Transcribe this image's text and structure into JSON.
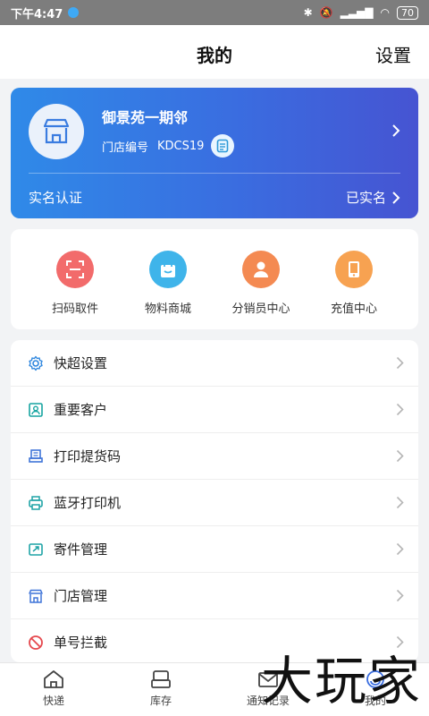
{
  "status_bar": {
    "time": "下午4:47",
    "battery": "70"
  },
  "header": {
    "title": "我的",
    "settings_label": "设置"
  },
  "store_card": {
    "name": "御景苑一期邻",
    "code_label": "门店编号",
    "code_value": "KDCS19",
    "verify_label": "实名认证",
    "verify_status": "已实名"
  },
  "quick_actions": [
    {
      "label": "扫码取件",
      "color": "#f26b6b"
    },
    {
      "label": "物料商城",
      "color": "#3fb4ea"
    },
    {
      "label": "分销员中心",
      "color": "#f48a52"
    },
    {
      "label": "充值中心",
      "color": "#f7a251"
    }
  ],
  "menu": {
    "items": [
      {
        "label": "快超设置",
        "icon": "gear-icon",
        "color": "#2e86de"
      },
      {
        "label": "重要客户",
        "icon": "contact-card-icon",
        "color": "#16a4a0"
      },
      {
        "label": "打印提货码",
        "icon": "print-code-icon",
        "color": "#3f74d8"
      },
      {
        "label": "蓝牙打印机",
        "icon": "printer-icon",
        "color": "#1fa3a6"
      },
      {
        "label": "寄件管理",
        "icon": "send-package-icon",
        "color": "#1fa3a6"
      },
      {
        "label": "门店管理",
        "icon": "store-icon",
        "color": "#3f74d8"
      },
      {
        "label": "单号拦截",
        "icon": "block-icon",
        "color": "#e5484d"
      }
    ]
  },
  "tabs": [
    {
      "label": "快递",
      "icon": "home-icon"
    },
    {
      "label": "库存",
      "icon": "inventory-icon"
    },
    {
      "label": "通知记录",
      "icon": "mail-icon"
    },
    {
      "label": "我的",
      "icon": "profile-icon"
    }
  ],
  "watermark": "大玩家"
}
